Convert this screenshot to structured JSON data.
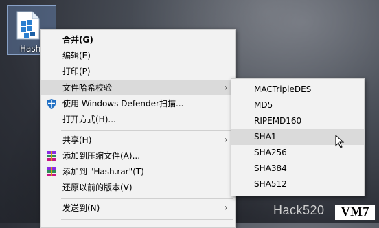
{
  "desktop": {
    "icon_label": "Hash"
  },
  "menu": {
    "items": [
      {
        "label": "合并(G)"
      },
      {
        "label": "编辑(E)"
      },
      {
        "label": "打印(P)"
      },
      {
        "label": "文件哈希校验"
      },
      {
        "label": "使用 Windows Defender扫描..."
      },
      {
        "label": "打开方式(H)..."
      },
      {
        "label": "共享(H)"
      },
      {
        "label": "添加到压缩文件(A)..."
      },
      {
        "label": "添加到 \"Hash.rar\"(T)"
      },
      {
        "label": "还原以前的版本(V)"
      },
      {
        "label": "发送到(N)"
      }
    ]
  },
  "submenu": {
    "items": [
      {
        "label": "MACTripleDES"
      },
      {
        "label": "MD5"
      },
      {
        "label": "RIPEMD160"
      },
      {
        "label": "SHA1"
      },
      {
        "label": "SHA256"
      },
      {
        "label": "SHA384"
      },
      {
        "label": "SHA512"
      }
    ]
  },
  "watermark": {
    "text": "Hack520",
    "badge": "VM7"
  }
}
